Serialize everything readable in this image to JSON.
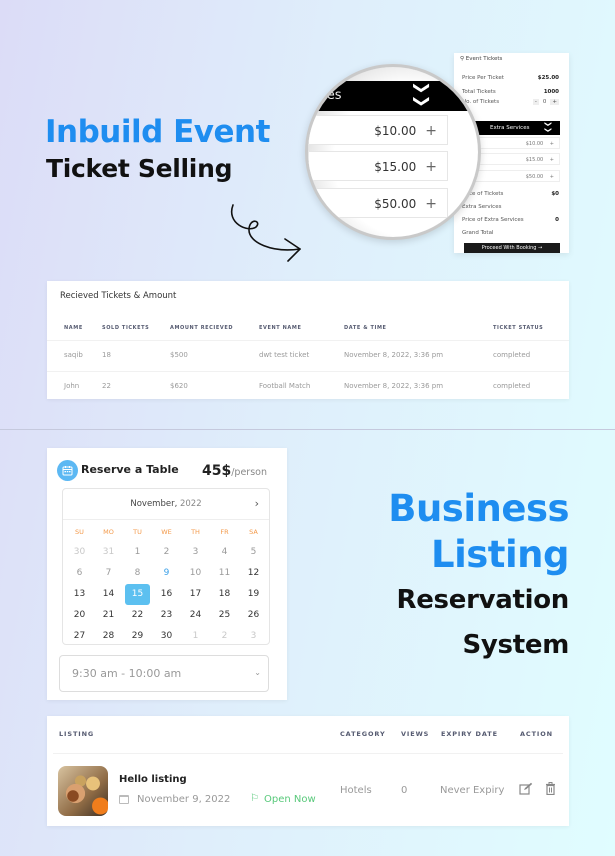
{
  "section1": {
    "heading_blue": "Inbuild Event",
    "heading_black": "Ticket Selling"
  },
  "ticket_panel": {
    "title": "Event Tickets",
    "rows": [
      {
        "label": "Price Per Ticket",
        "value": "$25.00"
      },
      {
        "label": "Total Tickets",
        "value": "1000"
      },
      {
        "label": "No. of Tickets",
        "value": ""
      }
    ],
    "qty": {
      "minus": "-",
      "value": "0",
      "plus": "+"
    },
    "extra_services_label": "Extra Services",
    "chevron": "❯❯",
    "services": [
      {
        "price": "$10.00",
        "add": "+"
      },
      {
        "price": "$15.00",
        "add": "+"
      },
      {
        "price": "$50.00",
        "add": "+"
      }
    ],
    "summary": [
      {
        "label": "Price of Tickets",
        "value": "$0"
      },
      {
        "label": "Extra Services",
        "value": ""
      },
      {
        "label": "Price of Extra Services",
        "value": "0"
      },
      {
        "label": "Grand Total",
        "value": ""
      }
    ],
    "proceed_button": "Proceed With Booking →"
  },
  "magnifier": {
    "bar_label": "ices",
    "chevron": "❯❯",
    "services": [
      {
        "price": "$10.00",
        "add": "+"
      },
      {
        "price": "$15.00",
        "add": "+"
      },
      {
        "price": "$50.00",
        "add": "+"
      }
    ]
  },
  "tickets_table": {
    "title": "Recieved Tickets & Amount",
    "columns": [
      "NAME",
      "SOLD TICKETS",
      "AMOUNT RECIEVED",
      "EVENT NAME",
      "DATE & TIME",
      "TICKET STATUS"
    ],
    "rows": [
      [
        "saqib",
        "18",
        "$500",
        "dwt test ticket",
        "November 8, 2022, 3:36 pm",
        "completed"
      ],
      [
        "John",
        "22",
        "$620",
        "Football Match",
        "November 8, 2022, 3:36 pm",
        "completed"
      ]
    ]
  },
  "reserve": {
    "title": "Reserve a Table",
    "price": "45$",
    "price_unit": "/person",
    "calendar": {
      "month": "November,",
      "year": "2022",
      "next": "›",
      "weekdays": [
        "SU",
        "MO",
        "TU",
        "WE",
        "TH",
        "FR",
        "SA"
      ],
      "days": [
        {
          "d": "30",
          "s": "muted"
        },
        {
          "d": "31",
          "s": "muted"
        },
        {
          "d": "1",
          "s": "past"
        },
        {
          "d": "2",
          "s": "past"
        },
        {
          "d": "3",
          "s": "past"
        },
        {
          "d": "4",
          "s": "past"
        },
        {
          "d": "5",
          "s": "past"
        },
        {
          "d": "6",
          "s": "past"
        },
        {
          "d": "7",
          "s": "past"
        },
        {
          "d": "8",
          "s": "past"
        },
        {
          "d": "9",
          "s": "today"
        },
        {
          "d": "10",
          "s": "past"
        },
        {
          "d": "11",
          "s": "past"
        },
        {
          "d": "12",
          "s": ""
        },
        {
          "d": "13",
          "s": ""
        },
        {
          "d": "14",
          "s": ""
        },
        {
          "d": "15",
          "s": "sel"
        },
        {
          "d": "16",
          "s": ""
        },
        {
          "d": "17",
          "s": ""
        },
        {
          "d": "18",
          "s": ""
        },
        {
          "d": "19",
          "s": ""
        },
        {
          "d": "20",
          "s": ""
        },
        {
          "d": "21",
          "s": ""
        },
        {
          "d": "22",
          "s": ""
        },
        {
          "d": "23",
          "s": ""
        },
        {
          "d": "24",
          "s": ""
        },
        {
          "d": "25",
          "s": ""
        },
        {
          "d": "26",
          "s": ""
        },
        {
          "d": "27",
          "s": ""
        },
        {
          "d": "28",
          "s": ""
        },
        {
          "d": "29",
          "s": ""
        },
        {
          "d": "30",
          "s": ""
        },
        {
          "d": "1",
          "s": "muted"
        },
        {
          "d": "2",
          "s": "muted"
        },
        {
          "d": "3",
          "s": "muted"
        }
      ]
    },
    "time_slot": "9:30 am - 10:00 am",
    "time_chevron": "⌄"
  },
  "section2": {
    "line1": "Business",
    "line2": "Listing",
    "line3": "Reservation",
    "line4": "System"
  },
  "listing_table": {
    "columns": {
      "listing": "LISTING",
      "category": "CATEGORY",
      "views": "VIEWS",
      "expiry": "EXPIRY DATE",
      "action": "ACTION"
    },
    "row": {
      "name": "Hello listing",
      "date": "November 9, 2022",
      "status": "Open Now",
      "category": "Hotels",
      "views": "0",
      "expiry": "Never Expiry"
    }
  },
  "colors": {
    "accent_blue": "#1e8df0",
    "calendar_selected": "#5cc0f0",
    "weekday_orange": "#f39a4b",
    "open_green": "#59c97b"
  }
}
